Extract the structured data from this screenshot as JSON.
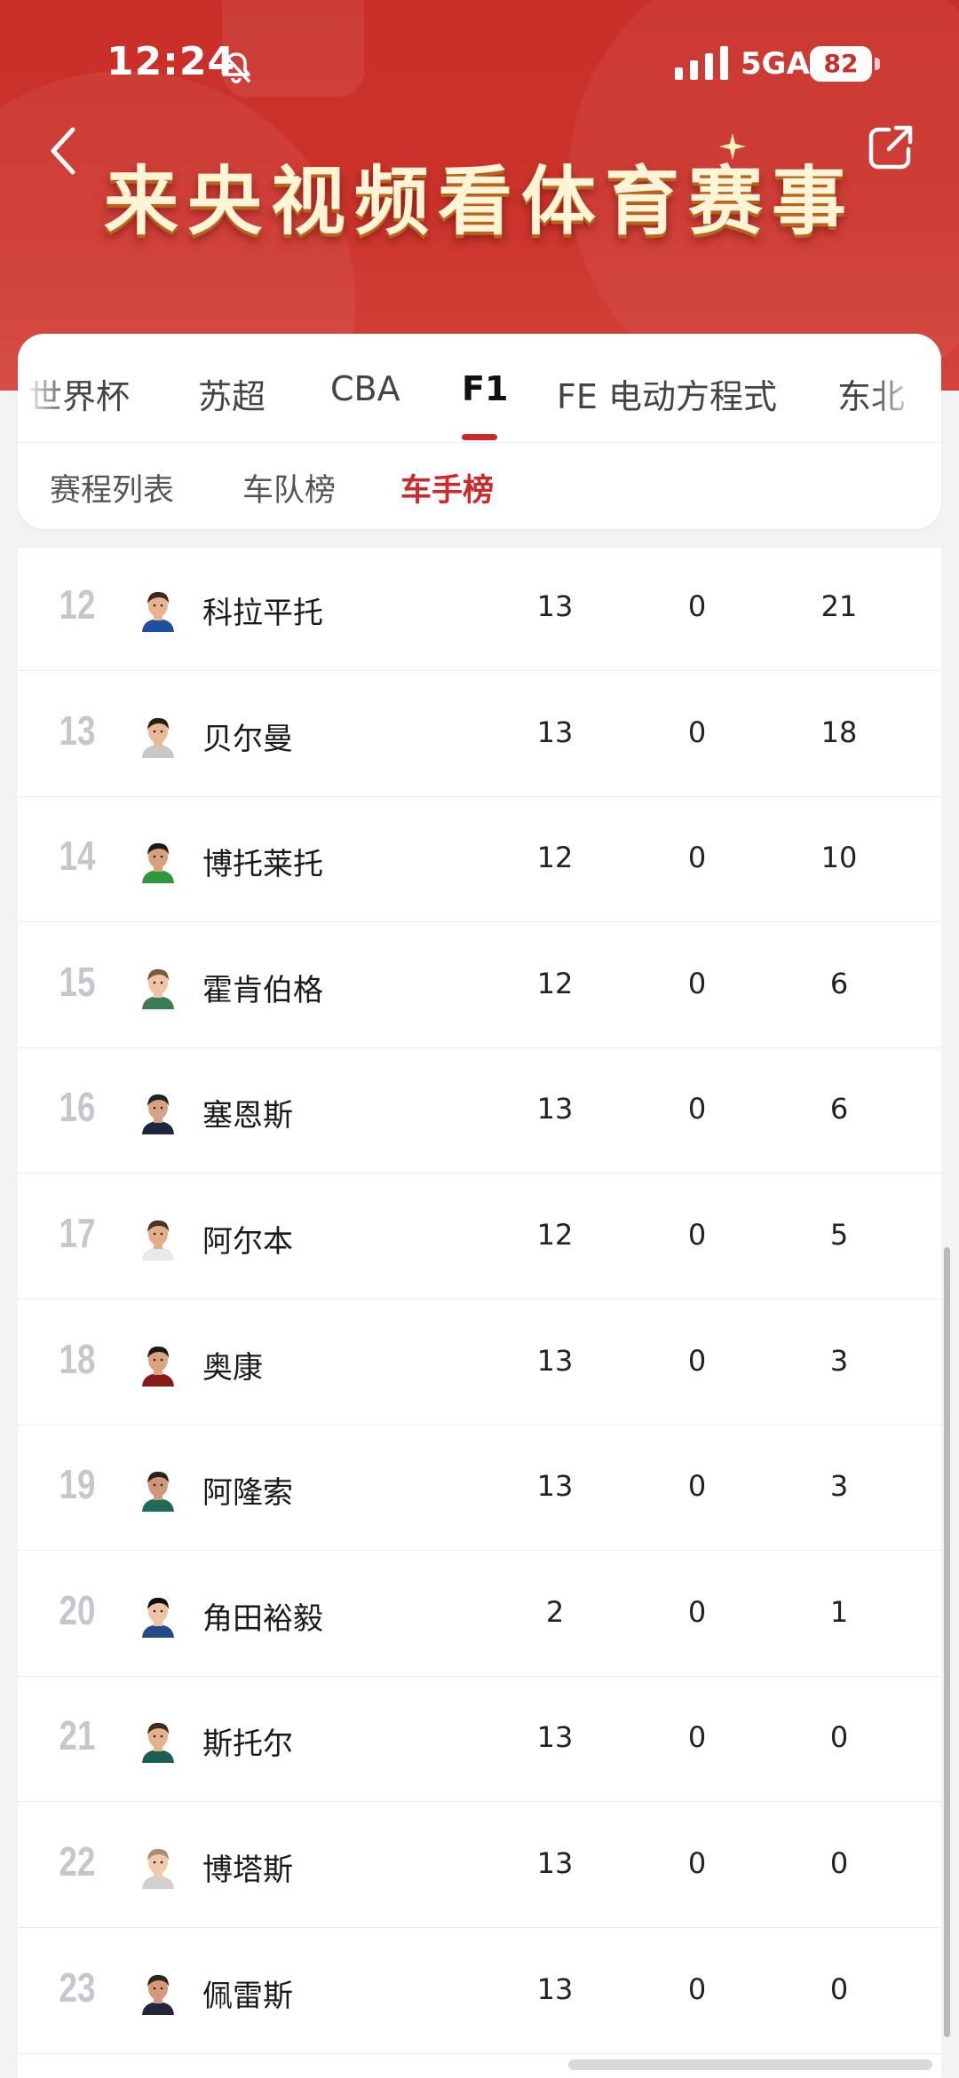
{
  "status_bar": {
    "time": "12:24",
    "network": "5GA",
    "battery": "82"
  },
  "header": {
    "banner_title": "来央视频看体育赛事"
  },
  "main_tabs": [
    {
      "label": "世界杯"
    },
    {
      "label": "苏超"
    },
    {
      "label": "CBA"
    },
    {
      "label": "F1",
      "active": true
    },
    {
      "label": "FE 电动方程式"
    },
    {
      "label": "东北"
    }
  ],
  "sub_tabs": [
    {
      "label": "赛程列表"
    },
    {
      "label": "车队榜"
    },
    {
      "label": "车手榜",
      "active": true
    }
  ],
  "drivers": [
    {
      "rank": "12",
      "name": "科拉平托",
      "races": "13",
      "wins": "0",
      "points": "21"
    },
    {
      "rank": "13",
      "name": "贝尔曼",
      "races": "13",
      "wins": "0",
      "points": "18"
    },
    {
      "rank": "14",
      "name": "博托莱托",
      "races": "12",
      "wins": "0",
      "points": "10"
    },
    {
      "rank": "15",
      "name": "霍肯伯格",
      "races": "12",
      "wins": "0",
      "points": "6"
    },
    {
      "rank": "16",
      "name": "塞恩斯",
      "races": "13",
      "wins": "0",
      "points": "6"
    },
    {
      "rank": "17",
      "name": "阿尔本",
      "races": "12",
      "wins": "0",
      "points": "5"
    },
    {
      "rank": "18",
      "name": "奥康",
      "races": "13",
      "wins": "0",
      "points": "3"
    },
    {
      "rank": "19",
      "name": "阿隆索",
      "races": "13",
      "wins": "0",
      "points": "3"
    },
    {
      "rank": "20",
      "name": "角田裕毅",
      "races": "2",
      "wins": "0",
      "points": "1"
    },
    {
      "rank": "21",
      "name": "斯托尔",
      "races": "13",
      "wins": "0",
      "points": "0"
    },
    {
      "rank": "22",
      "name": "博塔斯",
      "races": "13",
      "wins": "0",
      "points": "0"
    },
    {
      "rank": "23",
      "name": "佩雷斯",
      "races": "13",
      "wins": "0",
      "points": "0"
    }
  ],
  "colors": {
    "accent": "#d0272a",
    "header_red": "#c92f28",
    "rank_gray": "#c4c7cc"
  },
  "icons": [
    "bell-off-icon",
    "signal-icon",
    "battery-icon",
    "back-icon",
    "share-icon",
    "avatar"
  ]
}
